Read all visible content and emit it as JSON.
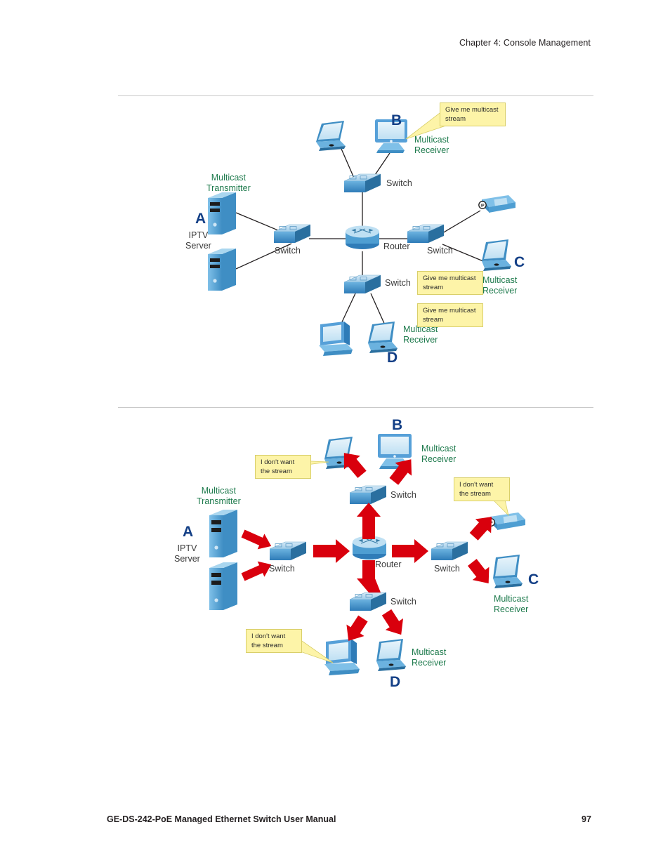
{
  "header": {
    "chapter": "Chapter 4: Console Management"
  },
  "footer": {
    "manual_title": "GE-DS-242-PoE Managed Ethernet Switch User Manual",
    "page_number": "97"
  },
  "colors": {
    "device_blue": "#56a0d8",
    "device_blue_dark": "#2f7cb8",
    "letter_navy": "#133f86",
    "receiver_green": "#1d7a4c",
    "callout_fill": "#fdf4a8",
    "callout_border": "#d9cf6a",
    "arrow_red": "#d9000d",
    "link_line": "#231f20",
    "rule_gray": "#c9c9c9"
  },
  "figures": [
    {
      "id": "figure-igmp-join",
      "name": "igmp-multicast-join-diagram",
      "letters": [
        {
          "text": "A"
        },
        {
          "text": "B"
        },
        {
          "text": "C"
        },
        {
          "text": "D"
        }
      ],
      "labels": {
        "transmitter": "Multicast\nTransmitter",
        "iptv_server": "IPTV\nServer",
        "router": "Router",
        "switch_left": "Switch",
        "switch_top": "Switch",
        "switch_right": "Switch",
        "switch_bottom": "Switch",
        "receiver_b": "Multicast\nReceiver",
        "receiver_c": "Multicast\nReceiver",
        "receiver_d": "Multicast\nReceiver"
      },
      "callouts": [
        {
          "name": "callout-b",
          "text": "Give me multicast\nstream"
        },
        {
          "name": "callout-c",
          "text": "Give me multicast\nstream"
        },
        {
          "name": "callout-d",
          "text": "Give me multicast\nstream"
        }
      ]
    },
    {
      "id": "figure-igmp-leave",
      "name": "igmp-multicast-leave-diagram",
      "letters": [
        {
          "text": "A"
        },
        {
          "text": "B"
        },
        {
          "text": "C"
        },
        {
          "text": "D"
        }
      ],
      "labels": {
        "transmitter": "Multicast\nTransmitter",
        "iptv_server": "IPTV\nServer",
        "router": "Router",
        "switch_left": "Switch",
        "switch_top": "Switch",
        "switch_right": "Switch",
        "switch_bottom": "Switch",
        "receiver_b": "Multicast\nReceiver",
        "receiver_c": "Multicast\nReceiver",
        "receiver_d": "Multicast\nReceiver"
      },
      "callouts": [
        {
          "name": "callout-b",
          "text": "I don't want\nthe stream"
        },
        {
          "name": "callout-c",
          "text": "I don't want\nthe stream"
        },
        {
          "name": "callout-d",
          "text": "I don't want\nthe stream"
        }
      ]
    }
  ]
}
